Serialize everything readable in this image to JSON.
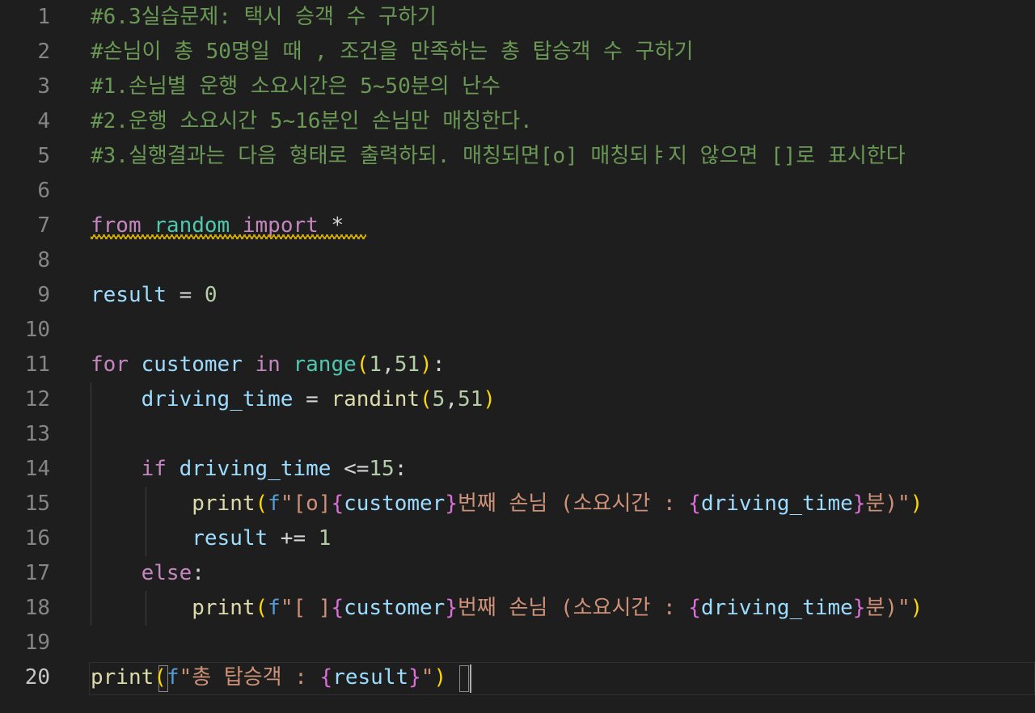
{
  "editor": {
    "lines": [
      {
        "num": "1",
        "comment": "#6.3실습문제: 택시 승객 수 구하기"
      },
      {
        "num": "2",
        "comment": "#손님이 총 50명일 때 , 조건을 만족하는 총 탑승객 수 구하기"
      },
      {
        "num": "3",
        "comment": "#1.손님별 운행 소요시간은 5~50분의 난수"
      },
      {
        "num": "4",
        "comment": "#2.운행 소요시간 5~16분인 손님만 매칭한다."
      },
      {
        "num": "5",
        "comment": "#3.실행결과는 다음 형태로 출력하되. 매칭되면[o] 매칭되ㅑ지 않으면 []로 표시한다"
      },
      {
        "num": "6"
      },
      {
        "num": "7",
        "t": {
          "from": "from",
          "sp1": " ",
          "module": "random",
          "sp2": " ",
          "import": "import",
          "sp3": " ",
          "star": "*"
        }
      },
      {
        "num": "8"
      },
      {
        "num": "9",
        "t": {
          "var": "result",
          "eq": " = ",
          "zero": "0"
        }
      },
      {
        "num": "10"
      },
      {
        "num": "11",
        "t": {
          "for": "for",
          "sp1": " ",
          "var": "customer",
          "sp2": " ",
          "in": "in",
          "sp3": " ",
          "range": "range",
          "open": "(",
          "a": "1",
          "comma": ",",
          "b": "51",
          "close": ")",
          "colon": ":"
        }
      },
      {
        "num": "12",
        "t": {
          "indent": "    ",
          "var": "driving_time",
          "eq": " = ",
          "fn": "randint",
          "open": "(",
          "a": "5",
          "comma": ",",
          "b": "51",
          "close": ")"
        }
      },
      {
        "num": "13"
      },
      {
        "num": "14",
        "t": {
          "indent": "    ",
          "if": "if",
          "sp1": " ",
          "var": "driving_time",
          "op": " <=",
          "n": "15",
          "colon": ":"
        }
      },
      {
        "num": "15",
        "t": {
          "indent": "        ",
          "fn": "print",
          "open": "(",
          "f": "f",
          "s1": "\"[o]",
          "b1o": "{",
          "v1": "customer",
          "b1c": "}",
          "s2": "번째 손님 (소요시간 : ",
          "b2o": "{",
          "v2": "driving_time",
          "b2c": "}",
          "s3": "분)\"",
          "close": ")"
        }
      },
      {
        "num": "16",
        "t": {
          "indent": "        ",
          "var": "result",
          "op": " += ",
          "n": "1"
        }
      },
      {
        "num": "17",
        "t": {
          "indent": "    ",
          "else": "else",
          "colon": ":"
        }
      },
      {
        "num": "18",
        "t": {
          "indent": "        ",
          "fn": "print",
          "open": "(",
          "f": "f",
          "s1": "\"[ ]",
          "b1o": "{",
          "v1": "customer",
          "b1c": "}",
          "s2": "번째 손님 (소요시간 : ",
          "b2o": "{",
          "v2": "driving_time",
          "b2c": "}",
          "s3": "분)\"",
          "close": ")"
        }
      },
      {
        "num": "19"
      },
      {
        "num": "20",
        "t": {
          "fn": "print",
          "open": "(",
          "f": "f",
          "s1": "\"총 탑승객 : ",
          "b1o": "{",
          "v1": "result",
          "b1c": "}",
          "s2": "\"",
          "close": ")"
        }
      }
    ]
  },
  "colors": {
    "background": "#1e1e1e",
    "comment": "#6a9955",
    "keyword_control": "#c586c0",
    "keyword": "#569cd6",
    "module": "#4ec9b0",
    "variable": "#9cdcfe",
    "number": "#b5cea8",
    "function": "#dcdcaa",
    "string": "#ce9178",
    "bracket_level1": "#ffd700",
    "bracket_level2": "#da70d6",
    "warning_squiggle": "#cca700"
  }
}
